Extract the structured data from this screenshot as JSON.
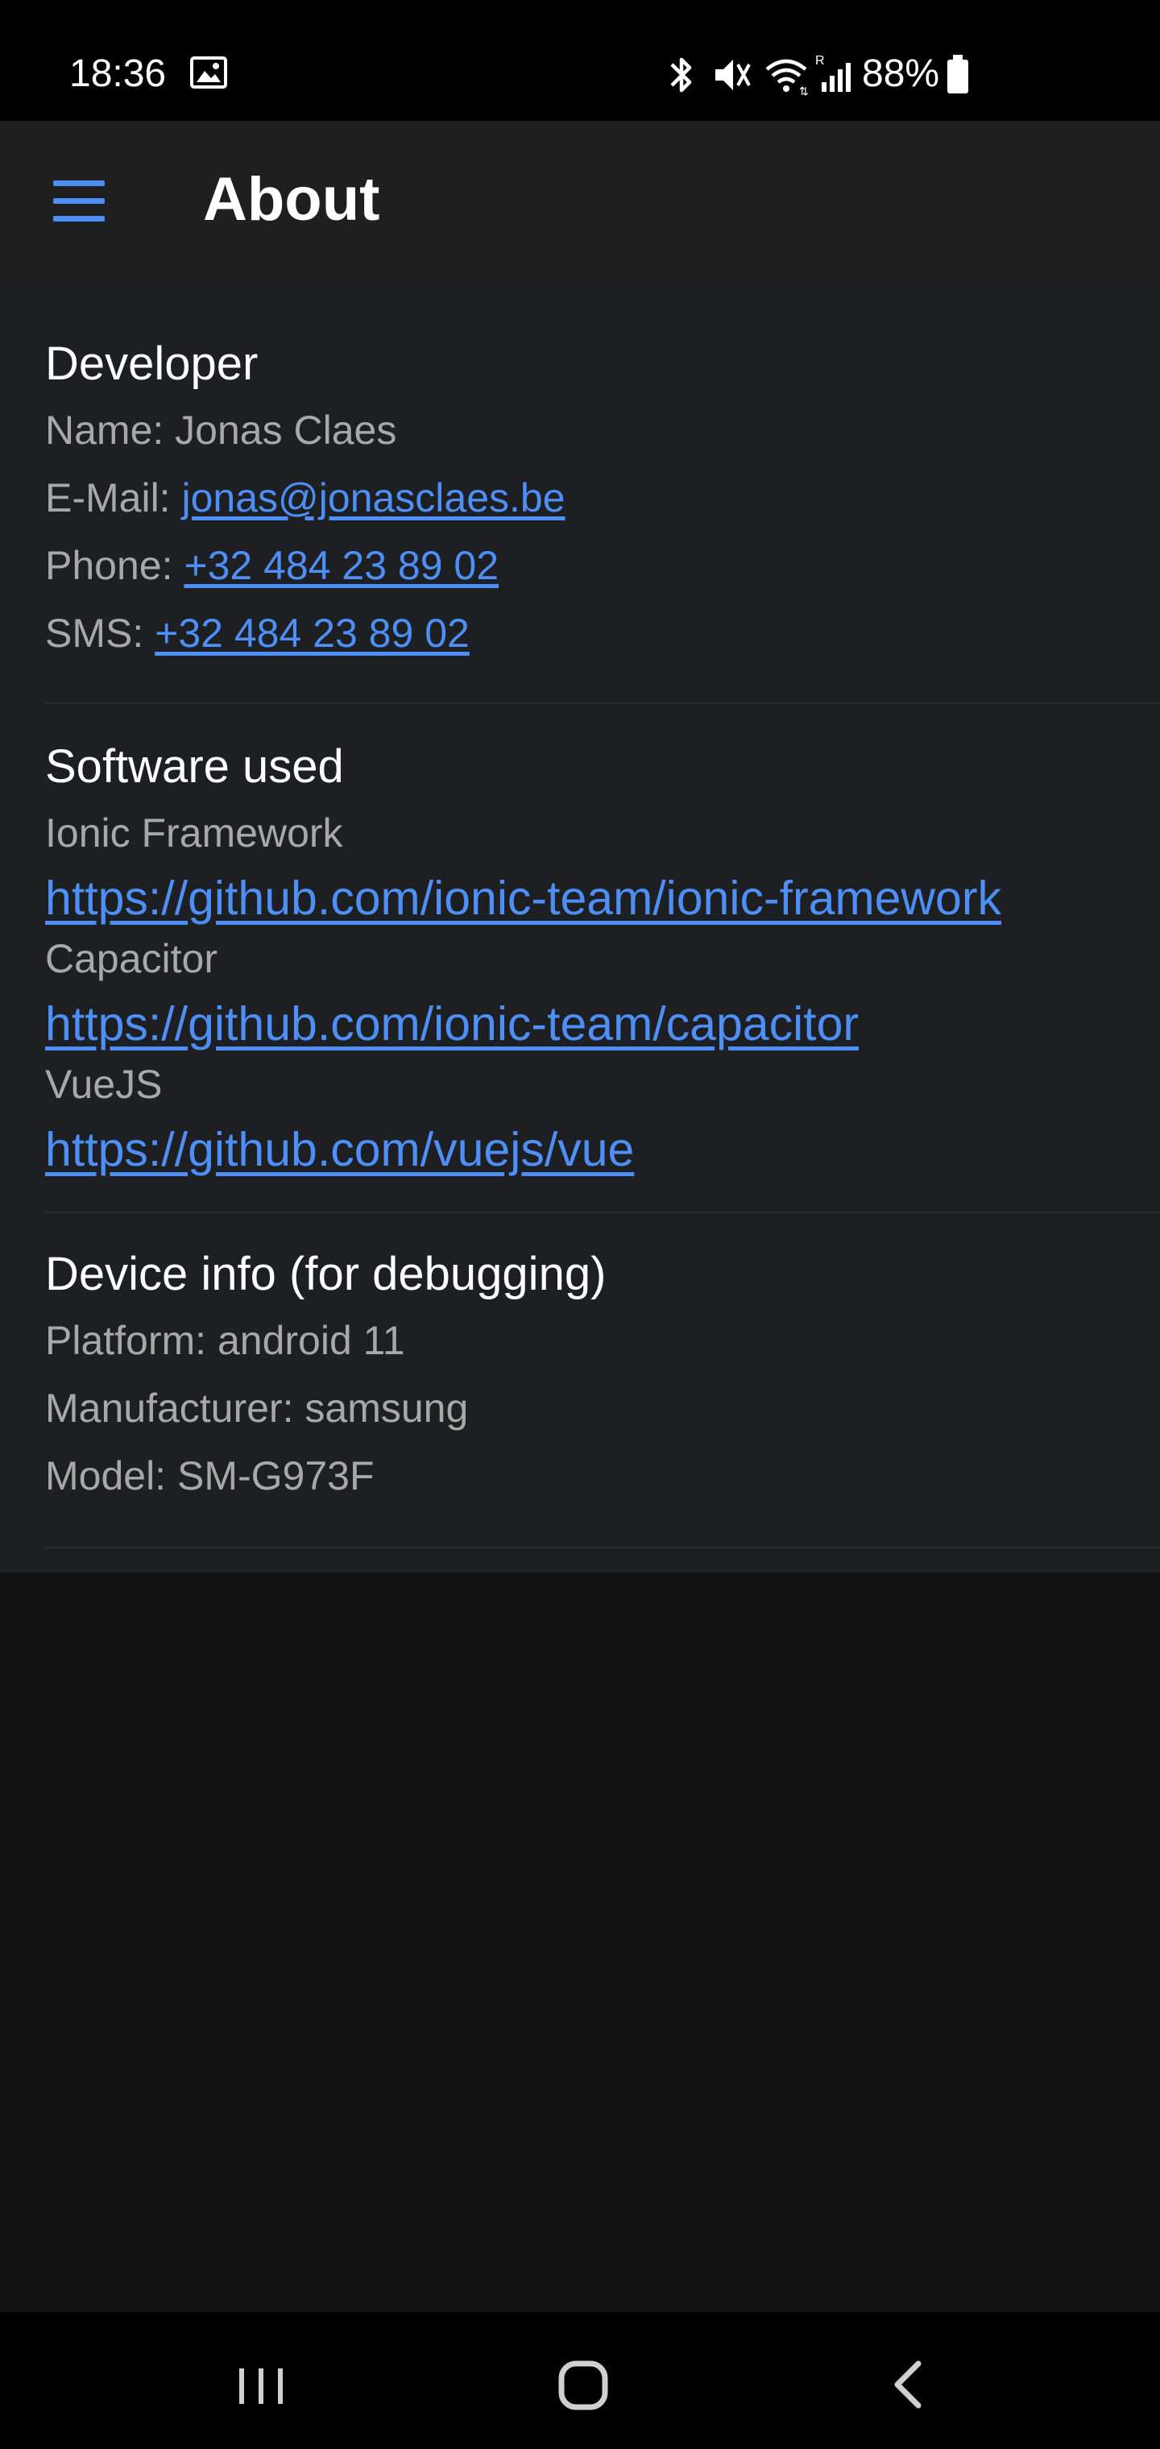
{
  "status_bar": {
    "time": "18:36",
    "battery": "88%",
    "icons": [
      "gallery-icon",
      "bluetooth-icon",
      "mute-icon",
      "wifi-icon",
      "signal-icon",
      "battery-icon"
    ]
  },
  "toolbar": {
    "title": "About",
    "menu_icon": "menu-icon",
    "accent": "#4d8ff5"
  },
  "developer": {
    "title": "Developer",
    "name_label": "Name:",
    "name_value": "Jonas Claes",
    "email_label": "E-Mail:",
    "email_value": "jonas@jonasclaes.be",
    "phone_label": "Phone:",
    "phone_value": "+32 484 23 89 02",
    "sms_label": "SMS:",
    "sms_value": "+32 484 23 89 02"
  },
  "software": {
    "title": "Software used",
    "items": [
      {
        "name": "Ionic Framework",
        "url": "https://github.com/ionic-team/ionic-framework"
      },
      {
        "name": "Capacitor",
        "url": "https://github.com/ionic-team/capacitor"
      },
      {
        "name": "VueJS",
        "url": "https://github.com/vuejs/vue"
      }
    ]
  },
  "device": {
    "title": "Device info (for debugging)",
    "platform_label": "Platform:",
    "platform_value": "android 11",
    "manufacturer_label": "Manufacturer:",
    "manufacturer_value": "samsung",
    "model_label": "Model:",
    "model_value": "SM-G973F"
  },
  "nav_bar": {
    "icons": [
      "recents-icon",
      "home-icon",
      "back-icon"
    ]
  }
}
